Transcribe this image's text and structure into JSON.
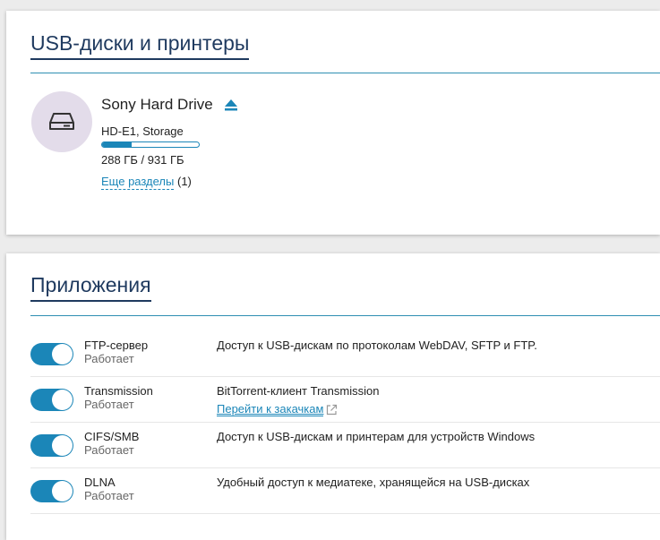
{
  "usb_section": {
    "title": "USB-диски и принтеры",
    "device": {
      "icon": "hard-drive-icon",
      "name": "Sony Hard Drive",
      "subtitle": "HD-E1, Storage",
      "usage_fraction": 0.31,
      "usage_text": "288 ГБ / 931 ГБ",
      "more_link": "Еще разделы",
      "more_count": "(1)"
    }
  },
  "apps_section": {
    "title": "Приложения",
    "apps": [
      {
        "name": "FTP-сервер",
        "status": "Работает",
        "enabled": true,
        "description": "Доступ к USB-дискам по протоколам WebDAV, SFTP и FTP.",
        "link": ""
      },
      {
        "name": "Transmission",
        "status": "Работает",
        "enabled": true,
        "description": "BitTorrent-клиент Transmission",
        "link": "Перейти к закачкам"
      },
      {
        "name": "CIFS/SMB",
        "status": "Работает",
        "enabled": true,
        "description": "Доступ к USB-дискам и принтерам для устройств Windows",
        "link": ""
      },
      {
        "name": "DLNA",
        "status": "Работает",
        "enabled": true,
        "description": "Удобный доступ к медиатеке, хранящейся на USB-дисках",
        "link": ""
      }
    ]
  },
  "colors": {
    "accent": "#1b86b8",
    "title": "#1f3a5f",
    "avatar_bg": "#e3dcea"
  }
}
